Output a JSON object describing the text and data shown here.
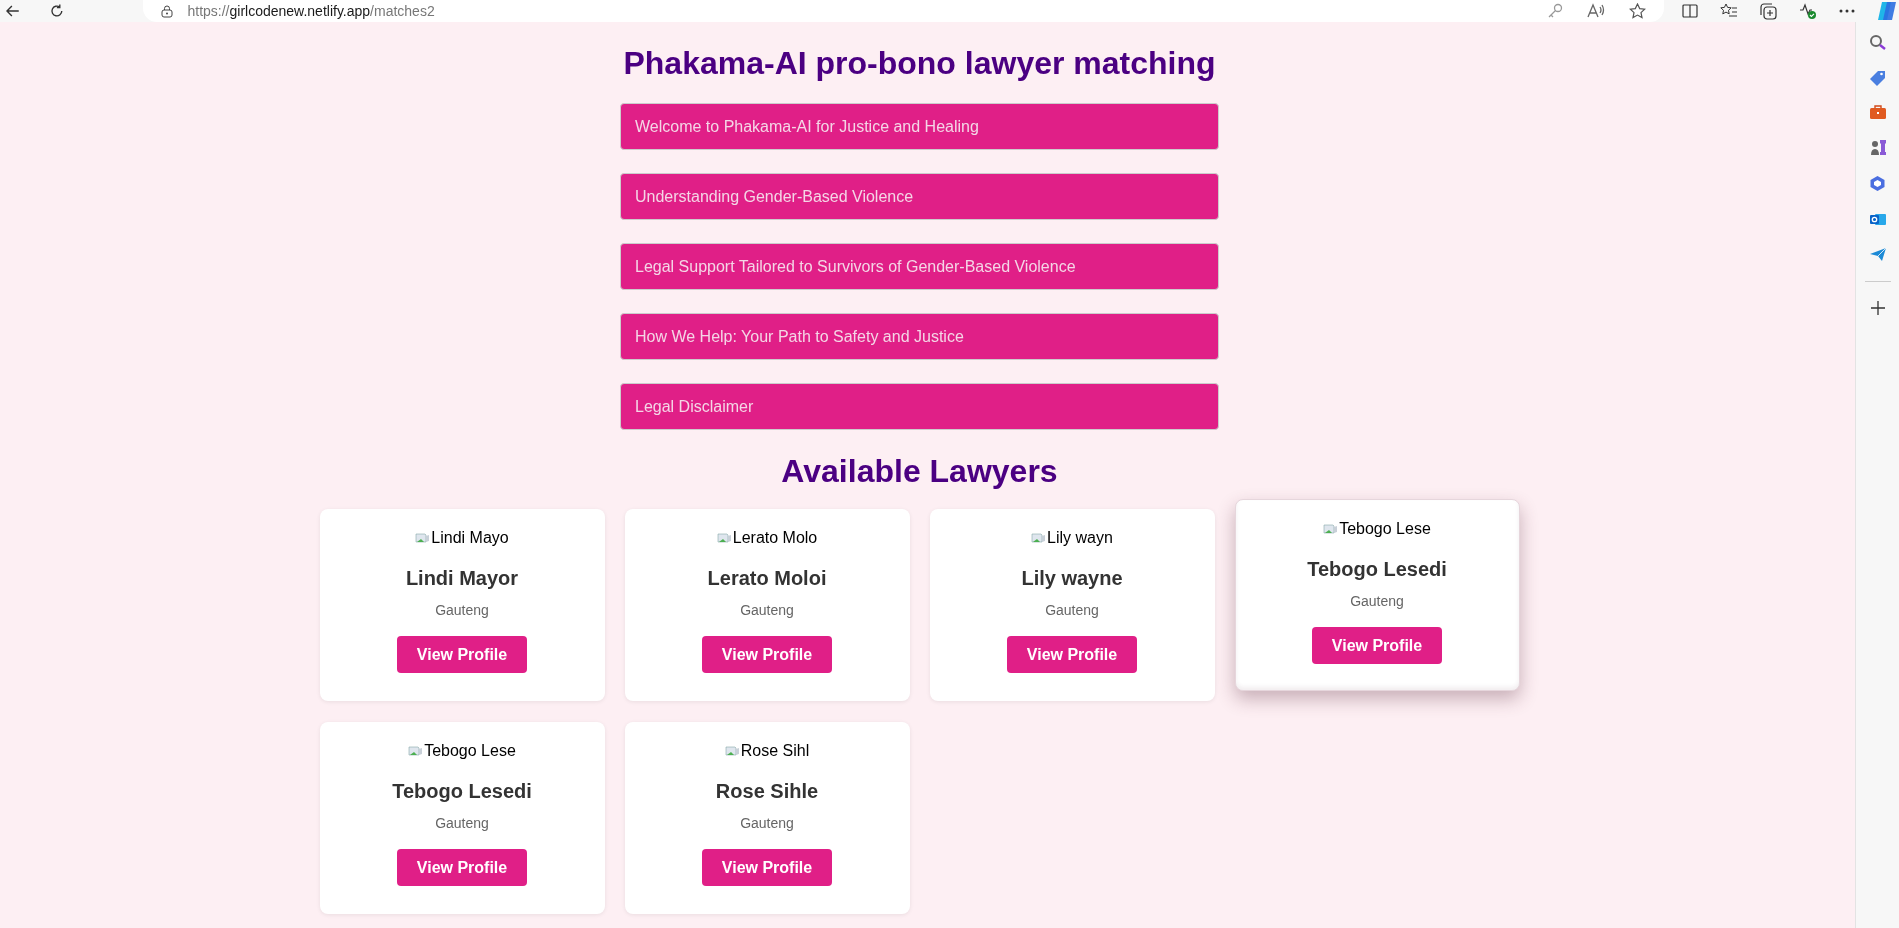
{
  "browser": {
    "url_scheme": "https://",
    "url_host": "girlcodenew.netlify.app",
    "url_path": "/matches2"
  },
  "page": {
    "title": "Phakama-AI pro-bono lawyer matching",
    "sections": [
      {
        "title": "Welcome to Phakama-AI for Justice and Healing"
      },
      {
        "title": "Understanding Gender-Based Violence"
      },
      {
        "title": "Legal Support Tailored to Survivors of Gender-Based Violence"
      },
      {
        "title": "How We Help: Your Path to Safety and Justice"
      },
      {
        "title": "Legal Disclaimer"
      }
    ],
    "lawyers_heading": "Available Lawyers",
    "lawyers": [
      {
        "image_alt": "Lindi Mayo",
        "name": "Lindi Mayor",
        "location": "Gauteng",
        "button": "View Profile",
        "raised": false
      },
      {
        "image_alt": "Lerato Molo",
        "name": "Lerato Moloi",
        "location": "Gauteng",
        "button": "View Profile",
        "raised": false
      },
      {
        "image_alt": "Lily wayn",
        "name": "Lily wayne",
        "location": "Gauteng",
        "button": "View Profile",
        "raised": false
      },
      {
        "image_alt": "Tebogo Lese",
        "name": "Tebogo Lesedi",
        "location": "Gauteng",
        "button": "View Profile",
        "raised": true
      },
      {
        "image_alt": "Tebogo Lese",
        "name": "Tebogo Lesedi",
        "location": "Gauteng",
        "button": "View Profile",
        "raised": false
      },
      {
        "image_alt": "Rose Sihl",
        "name": "Rose Sihle",
        "location": "Gauteng",
        "button": "View Profile",
        "raised": false
      }
    ]
  }
}
